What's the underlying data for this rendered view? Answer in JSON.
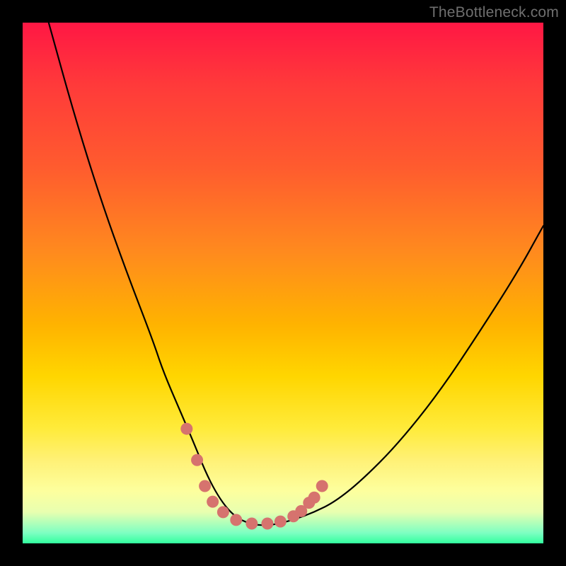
{
  "watermark": "TheBottleneck.com",
  "chart_data": {
    "type": "line",
    "title": "",
    "xlabel": "",
    "ylabel": "",
    "x_range": [
      0,
      100
    ],
    "y_range": [
      0,
      100
    ],
    "series": [
      {
        "name": "bottleneck-curve",
        "x": [
          5,
          10,
          15,
          20,
          25,
          27,
          30,
          33,
          35,
          37,
          39,
          41,
          43,
          45,
          48,
          52,
          56,
          60,
          65,
          72,
          80,
          88,
          95,
          100
        ],
        "y": [
          100,
          82,
          66,
          52,
          39,
          33,
          26,
          19,
          14,
          10,
          7,
          5,
          4,
          3.5,
          3.5,
          4.5,
          6,
          8,
          12,
          19,
          29,
          41,
          52,
          61
        ]
      }
    ],
    "markers": {
      "name": "emphasis-dots",
      "color": "#d6736e",
      "points": [
        {
          "x": 31.5,
          "y": 22
        },
        {
          "x": 33.5,
          "y": 16
        },
        {
          "x": 35,
          "y": 11
        },
        {
          "x": 36.5,
          "y": 8
        },
        {
          "x": 38.5,
          "y": 6
        },
        {
          "x": 41,
          "y": 4.5
        },
        {
          "x": 44,
          "y": 3.8
        },
        {
          "x": 47,
          "y": 3.8
        },
        {
          "x": 49.5,
          "y": 4.2
        },
        {
          "x": 52,
          "y": 5.2
        },
        {
          "x": 53.5,
          "y": 6.2
        },
        {
          "x": 55,
          "y": 7.8
        },
        {
          "x": 56,
          "y": 8.8
        },
        {
          "x": 57.5,
          "y": 11
        }
      ]
    }
  }
}
